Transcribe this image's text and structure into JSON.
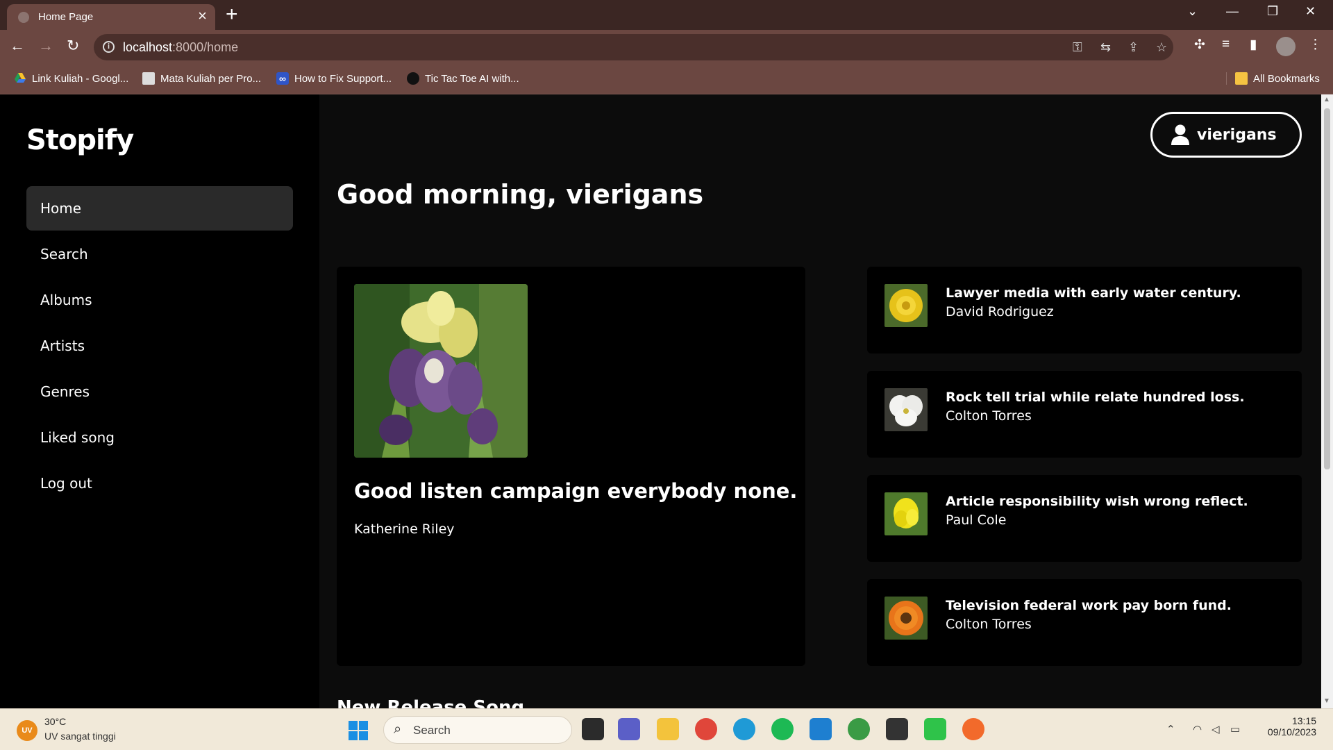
{
  "browser": {
    "tab_title": "Home Page",
    "url_host": "localhost",
    "url_path": ":8000/home",
    "bookmarks": [
      "Link Kuliah - Googl...",
      "Mata Kuliah per Pro...",
      "How to Fix Support...",
      "Tic Tac Toe AI with..."
    ],
    "all_bookmarks": "All Bookmarks"
  },
  "app": {
    "logo": "Stopify",
    "nav": [
      "Home",
      "Search",
      "Albums",
      "Artists",
      "Genres",
      "Liked song",
      "Log out"
    ],
    "active_nav": "Home",
    "user": "vierigans",
    "greeting": "Good morning, vierigans",
    "featured": {
      "title": "Good listen campaign everybody none.",
      "artist": "Katherine Riley"
    },
    "songs": [
      {
        "title": "Lawyer media with early water century.",
        "artist": "David Rodriguez"
      },
      {
        "title": "Rock tell trial while relate hundred loss.",
        "artist": "Colton Torres"
      },
      {
        "title": "Article responsibility wish wrong reflect.",
        "artist": "Paul Cole"
      },
      {
        "title": "Television federal work pay born fund.",
        "artist": "Colton Torres"
      }
    ],
    "next_section": "New Release Song"
  },
  "taskbar": {
    "weather_temp": "30°C",
    "weather_status": "UV sangat tinggi",
    "weather_badge": "UV",
    "search_label": "Search",
    "time": "13:15",
    "date": "09/10/2023"
  }
}
